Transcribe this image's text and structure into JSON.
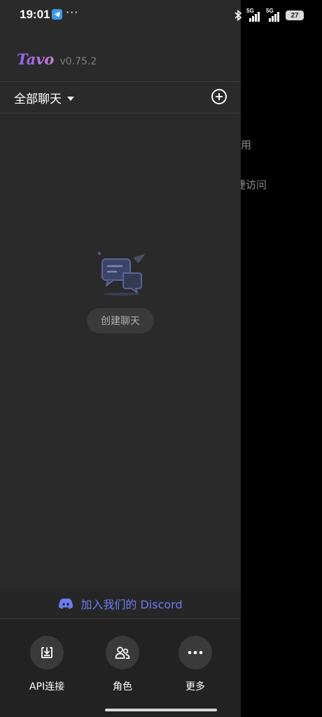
{
  "status_bar": {
    "time": "19:01",
    "more_dots": "···",
    "signal_1_label": "5G",
    "signal_2_label": "5G",
    "battery": "27"
  },
  "background_page": {
    "text_1": "用",
    "text_2": "捷访问"
  },
  "drawer": {
    "app_name": "Tavo",
    "version": "v0.75.2",
    "chat_filter_label": "全部聊天",
    "empty_state_button": "创建聊天",
    "discord_label": "加入我们的 Discord",
    "nav": {
      "api_label": "API连接",
      "characters_label": "角色",
      "more_label": "更多"
    }
  },
  "colors": {
    "drawer_bg": "#2a2a2a",
    "brand_gradient_start": "#8e5ff0",
    "brand_gradient_end": "#c77fd3",
    "discord": "#6c7cf2",
    "telegram": "#3b9be8"
  }
}
